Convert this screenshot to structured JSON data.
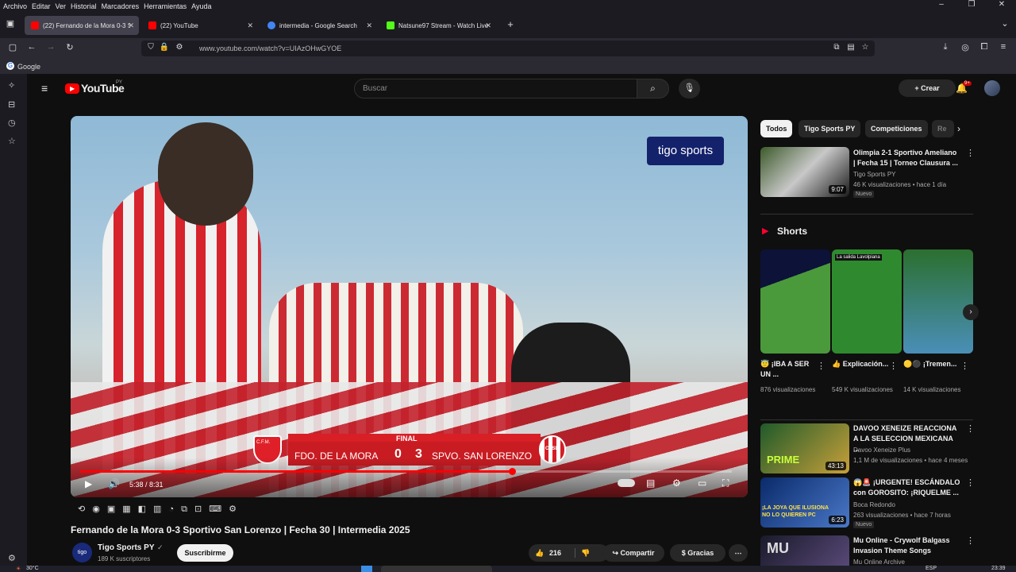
{
  "menu": [
    "Archivo",
    "Editar",
    "Ver",
    "Historial",
    "Marcadores",
    "Herramientas",
    "Ayuda"
  ],
  "tabs": [
    {
      "label": "(22) Fernando de la Mora 0-3 S",
      "color": "#ff0000"
    },
    {
      "label": "(22) YouTube",
      "color": "#ff0000"
    },
    {
      "label": "intermedia - Google Search",
      "color": "#4285f4"
    },
    {
      "label": "Natsune97 Stream - Watch Live",
      "color": "#53fc18"
    }
  ],
  "browser": {
    "url": "www.youtube.com/watch?v=UIAzOHwGYOE",
    "bookmark": "Google"
  },
  "youtube": {
    "logo_text": "YouTube",
    "logo_region": "PY",
    "search_placeholder": "Buscar",
    "create_label": "Crear",
    "notif_count": "9+"
  },
  "video": {
    "watermark": "tigo sports",
    "score": {
      "label": "FINAL",
      "home_badge": "C.F.M.",
      "home": "FDO. DE LA MORA",
      "home_score": "0",
      "away_score": "3",
      "away": "SPVO. SAN LORENZO",
      "away_badge": "CSSL"
    },
    "time": "5:38 / 8:31",
    "progress": 0.662,
    "title": "Fernando de la Mora 0-3 Sportivo San Lorenzo | Fecha 30 | Intermedia 2025",
    "channel": "Tigo Sports PY",
    "subs": "189 K suscriptores",
    "subscribe": "Suscribirme",
    "likes": "216",
    "share": "Compartir",
    "thanks": "Gracias"
  },
  "chips": [
    "Todos",
    "Tigo Sports PY",
    "Competiciones",
    "Re"
  ],
  "recs_top": {
    "title": "Olimpia 2-1 Sportivo Ameliano | Fecha 15 | Torneo Clausura ...",
    "channel": "Tigo Sports PY",
    "meta": "46 K visualizaciones • hace 1 día",
    "badge": "Nuevo",
    "duration": "9:07"
  },
  "shorts_header": "Shorts",
  "shorts": [
    {
      "title": "😇 ¡IBA A SER UN ...",
      "views": "876 visualizaciones"
    },
    {
      "title": "👍 Explicación...",
      "views": "549 K visualizaciones",
      "overlay": "La salida Lavolpiana"
    },
    {
      "title": "🟡⚫ ¡Tremen...",
      "views": "14 K visualizaciones"
    }
  ],
  "recs": [
    {
      "title": "DAVOO XENEIZE REACCIONA A LA SELECCION MEXICANA ...",
      "channel": "Davoo Xeneize Plus",
      "meta": "1,1 M de visualizaciones • hace 4 meses",
      "duration": "43:13",
      "overlay": "PRIME"
    },
    {
      "title": "😱🚨 ¡URGENTE! ESCÁNDALO con GOROSITO: ¡RIQUELME ...",
      "channel": "Boca Redondo",
      "meta": "263 visualizaciones • hace 7 horas",
      "badge": "Nuevo",
      "duration": "6:23",
      "overlay": "¡LA JOYA QUE ILUSIONA NO LO QUIEREN PC"
    },
    {
      "title": "Mu Online - Crywolf Balgass Invasion Theme Songs",
      "channel": "Mu Online Archive",
      "overlay": "MU"
    }
  ],
  "taskbar": {
    "temp": "30°C",
    "lang": "ESP",
    "time": "23:39"
  }
}
